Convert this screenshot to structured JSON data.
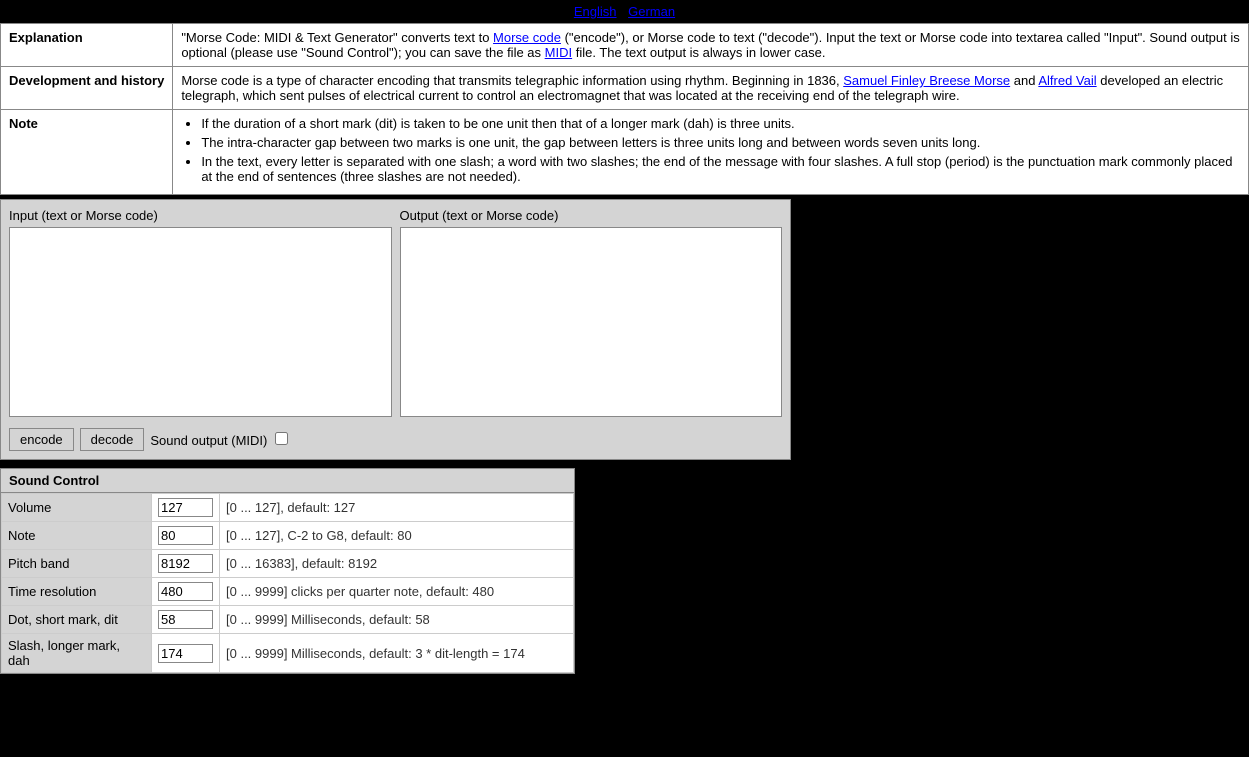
{
  "header": {
    "links": [
      {
        "label": "English",
        "href": "#"
      },
      {
        "label": "German",
        "href": "#"
      }
    ]
  },
  "info_table": {
    "rows": [
      {
        "label": "Explanation",
        "content": "\"Morse Code: MIDI & Text Generator\" converts text to Morse code (\"encode\"), or Morse code to text (\"decode\"). Input the text or Morse code into textarea called \"Input\". Sound output is optional (please use \"Sound Control\"); you can save the file as MIDI file. The text output is always in lower case.",
        "links": [
          {
            "text": "Morse code",
            "href": "#"
          },
          {
            "text": "MIDI",
            "href": "#"
          }
        ]
      },
      {
        "label": "Development and history",
        "content": "Morse code is a type of character encoding that transmits telegraphic information using rhythm. Beginning in 1836, Samuel Finley Breese Morse and Alfred Vail developed an electric telegraph, which sent pulses of electrical current to control an electromagnet that was located at the receiving end of the telegraph wire.",
        "links": [
          {
            "text": "Samuel Finley Breese Morse",
            "href": "#"
          },
          {
            "text": "Alfred Vail",
            "href": "#"
          }
        ]
      },
      {
        "label": "Note",
        "notes": [
          "If the duration of a short mark (dit) is taken to be one unit then that of a longer mark (dah) is three units.",
          "The intra-character gap between two marks is one unit, the gap between letters is three units long and between words seven units long.",
          "In the text, every letter is separated with one slash; a word with two slashes; the end of the message with four slashes. A full stop (period) is the punctuation mark commonly placed at the end of sentences (three slashes are not needed)."
        ]
      }
    ]
  },
  "io_section": {
    "input_label": "Input (text or Morse code)",
    "output_label": "Output (text or Morse code)",
    "encode_btn": "encode",
    "decode_btn": "decode",
    "sound_label": "Sound output (MIDI)"
  },
  "sound_control": {
    "header": "Sound Control",
    "rows": [
      {
        "label": "Volume",
        "value": "127",
        "description": "[0 ... 127], default: 127"
      },
      {
        "label": "Note",
        "value": "80",
        "description": "[0 ... 127], C-2 to G8, default: 80"
      },
      {
        "label": "Pitch band",
        "value": "8192",
        "description": "[0 ... 16383], default: 8192"
      },
      {
        "label": "Time resolution",
        "value": "480",
        "description": "[0 ... 9999] clicks per quarter note, default: 480"
      },
      {
        "label": "Dot, short mark, dit",
        "value": "58",
        "description": "[0 ... 9999] Milliseconds, default: 58"
      },
      {
        "label": "Slash, longer mark, dah",
        "value": "174",
        "description": "[0 ... 9999] Milliseconds, default: 3 * dit-length = 174"
      }
    ]
  }
}
